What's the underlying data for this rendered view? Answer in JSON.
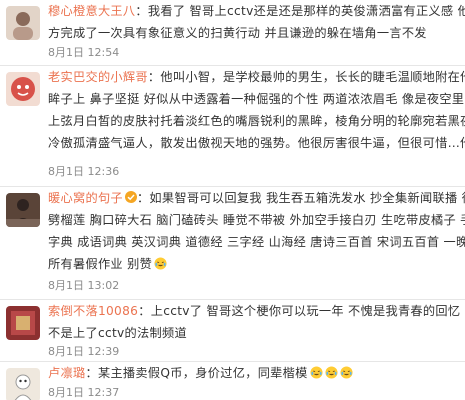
{
  "comments": [
    {
      "username": "穆心橙意大王八",
      "lines": [
        "：我看了  智哥上cctv还是还是那样的英俊潇洒富有正义感 他配合警",
        "方完成了一次具有象征意义的扫黄行动  并且谦逊的躲在墙角一言不发"
      ],
      "time": "8月1日 12:54",
      "avatar_color": "#d8c6b8"
    },
    {
      "username": "老实巴交的小辉哥",
      "lines": [
        "：他叫小智，是学校最帅的男生，长长的睫毛温顺地附在他深褐的",
        "眸子上 鼻子坚挺 好似从中透露着一种倔强的个性 两道浓浓眉毛 像是夜空里皎洁的",
        "上弦月白皙的皮肤衬托着淡红色的嘴唇锐利的黑眸，棱角分明的轮廓宛若黑夜中的鹰",
        "冷傲孤清盛气逼人，散发出傲视天地的强势。他很厉害很牛逼，但很可惜…他阳痿"
      ],
      "time": "8月1日 12:36",
      "avatar_color": "#c94a3c"
    },
    {
      "username": "暖心窝的句子",
      "lines": [
        "：如果智哥可以回复我 我生吞五箱洗发水 抄全集新闻联播 徒手",
        "劈榴莲 胸口碎大石 脑门磕砖头 睡觉不带被 外加空手接白刃 生吃带皮橘子 手抄中华",
        "字典 成语词典 英汉词典 道德经 三字经 山海经 唐诗三百首 宋词五百首 一晚上写完",
        "所有暑假作业 别赞"
      ],
      "time": "8月1日 13:02",
      "avatar_color": "#6b4a3a"
    },
    {
      "username": "索倒不落10086",
      "lines": [
        "：上cctv了 智哥这个梗你可以玩一年 不愧是我青春的回忆 说明是",
        "不是上了cctv的法制频道"
      ],
      "time": "8月1日 12:39",
      "avatar_color": "#9a3b3b"
    },
    {
      "username": "卢凛璐",
      "lines": [
        "：某主播卖假Q币，身价过亿，同辈楷模"
      ],
      "time": "8月1日 12:37",
      "avatar_color": "#e8e0d6"
    }
  ]
}
